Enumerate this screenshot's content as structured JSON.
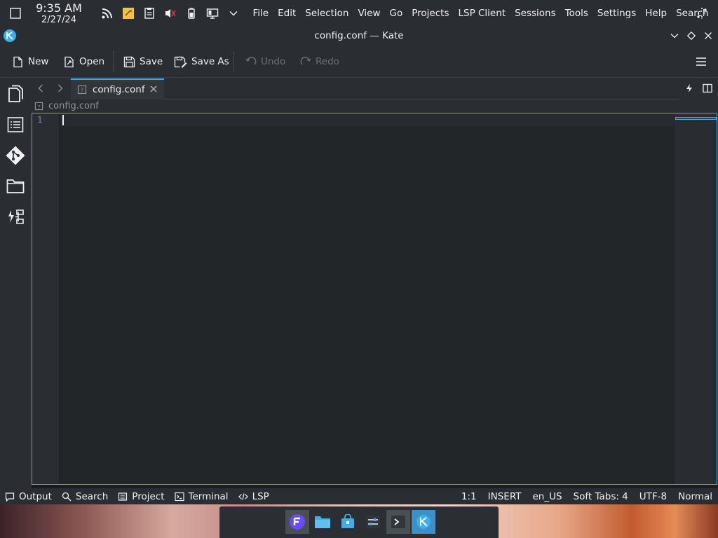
{
  "panel": {
    "clock": {
      "time": "9:35 AM",
      "date": "2/27/24"
    },
    "global_menu": [
      "File",
      "Edit",
      "Selection",
      "View",
      "Go",
      "Projects",
      "LSP Client",
      "Sessions",
      "Tools",
      "Settings",
      "Help",
      "Search"
    ]
  },
  "window": {
    "title": "config.conf — Kate"
  },
  "toolbar": {
    "new_label": "New",
    "open_label": "Open",
    "save_label": "Save",
    "save_as_label": "Save As",
    "undo_label": "Undo",
    "redo_label": "Redo"
  },
  "tabs": [
    {
      "label": "config.conf",
      "active": true
    }
  ],
  "breadcrumb": {
    "file": "config.conf"
  },
  "editor": {
    "line_numbers": [
      "1"
    ]
  },
  "bottom_tools": {
    "output": "Output",
    "search": "Search",
    "project": "Project",
    "terminal": "Terminal",
    "lsp": "LSP"
  },
  "status": {
    "cursor_position": "1:1",
    "mode": "INSERT",
    "dictionary": "en_US",
    "indentation": "Soft Tabs: 4",
    "encoding": "UTF-8",
    "input_mode": "Normal"
  },
  "colors": {
    "accent": "#3daee9",
    "panel": "#2a2e32",
    "editor_bg": "#232629"
  },
  "icons": {
    "sidebar": [
      "documents-icon",
      "symbol-list-icon",
      "git-icon",
      "filesystem-browser-icon",
      "projects-icon"
    ],
    "taskbar": [
      "app-launcher-icon",
      "file-manager-icon",
      "discover-icon",
      "system-settings-icon",
      "terminal-icon",
      "kate-icon"
    ]
  }
}
